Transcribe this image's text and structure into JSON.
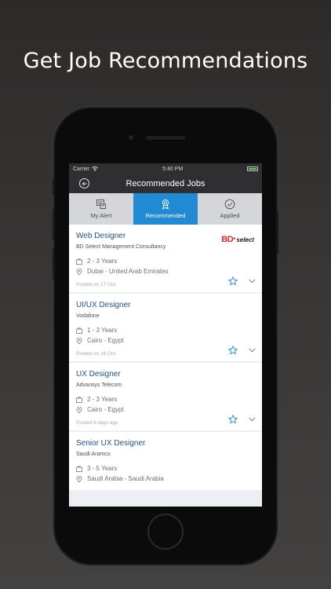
{
  "headline": "Get Job Recommendations",
  "status_bar": {
    "carrier": "Carrier",
    "time": "5:40 PM"
  },
  "nav": {
    "title": "Recommended Jobs",
    "back_icon": "back-arrow-circle-icon"
  },
  "tabs": [
    {
      "label": "My Alert",
      "icon": "alert-icon",
      "active": false
    },
    {
      "label": "Recommended",
      "icon": "award-icon",
      "active": true
    },
    {
      "label": "Applied",
      "icon": "check-circle-icon",
      "active": false
    }
  ],
  "jobs": [
    {
      "title": "Web Designer",
      "company": "BD Select Management Consultancy",
      "experience": "2 - 3 Years",
      "location": "Dubai - United Arab Emirates",
      "posted": "Posted on 17 Oct",
      "logo": "BD select"
    },
    {
      "title": "UI/UX Designer",
      "company": "Vodafone",
      "experience": "1 - 3 Years",
      "location": "Cairo - Egypt",
      "posted": "Posted on 18 Oct"
    },
    {
      "title": "UX Designer",
      "company": "Advansys Telecom",
      "experience": "2 - 3 Years",
      "location": "Cairo - Egypt",
      "posted": "Posted 9 days ago"
    },
    {
      "title": "Senior UX Designer",
      "company": "Saudi Aramco",
      "experience": "3 - 5 Years",
      "location": "Saudi Arabia  - Saudi Arabia",
      "posted": ""
    }
  ],
  "colors": {
    "accent": "#2289d3",
    "title_text": "#1f4f8f",
    "header_bg": "#2f2f32"
  }
}
